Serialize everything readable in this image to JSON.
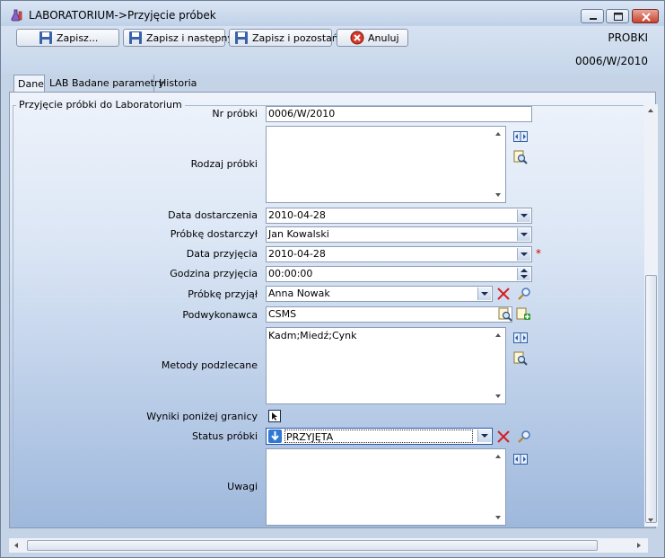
{
  "window": {
    "title": "LABORATORIUM->Przyjęcie próbek"
  },
  "toolbar": {
    "save_label": "Zapisz...",
    "save_next_label": "Zapisz i następny",
    "save_stay_label": "Zapisz i pozostań",
    "cancel_label": "Anuluj"
  },
  "header": {
    "module": "PROBKI",
    "record_id": "0006/W/2010"
  },
  "tabs": [
    {
      "label": "Dane",
      "active": true
    },
    {
      "label": "LAB Badane parametry",
      "active": false
    },
    {
      "label": "Historia",
      "active": false
    }
  ],
  "form": {
    "group_title": "Przyjęcie próbki do Laboratorium",
    "nr_probki": {
      "label": "Nr próbki",
      "value": "0006/W/2010"
    },
    "rodzaj_probki": {
      "label": "Rodzaj próbki",
      "value": ""
    },
    "data_dostarczenia": {
      "label": "Data dostarczenia",
      "value": "2010-04-28"
    },
    "probke_dostarczyl": {
      "label": "Próbkę dostarczył",
      "value": "Jan Kowalski"
    },
    "data_przyjecia": {
      "label": "Data przyjęcia",
      "value": "2010-04-28",
      "required_mark": "*"
    },
    "godzina_przyjecia": {
      "label": "Godzina przyjęcia",
      "value": "00:00:00"
    },
    "probke_przyjal": {
      "label": "Próbkę przyjął",
      "value": "Anna Nowak"
    },
    "podwykonawca": {
      "label": "Podwykonawca",
      "value": "CSMS"
    },
    "metody_podzlecane": {
      "label": "Metody podzlecane",
      "value": "Kadm;Miedź;Cynk"
    },
    "wyniki_ponizej_granicy": {
      "label": "Wyniki poniżej granicy",
      "checked": false
    },
    "status_probki": {
      "label": "Status próbki",
      "value": "PRZYJĘTA"
    },
    "uwagi": {
      "label": "Uwagi",
      "value": ""
    }
  },
  "colors": {
    "accent": "#2f78d4",
    "required": "#d40000",
    "delete_icon": "#d42020"
  }
}
